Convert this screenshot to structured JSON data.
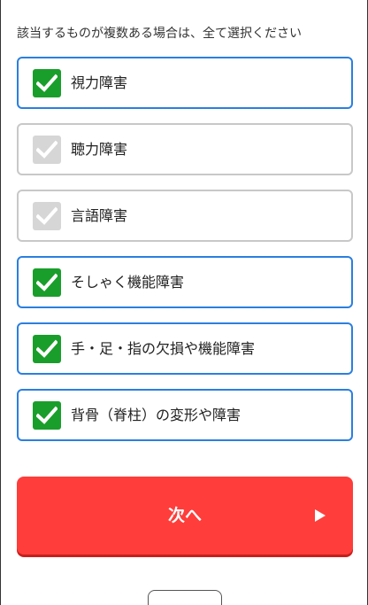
{
  "instruction": "該当するものが複数ある場合は、全て選択ください",
  "options": [
    {
      "label": "視力障害",
      "checked": true
    },
    {
      "label": "聴力障害",
      "checked": false
    },
    {
      "label": "言語障害",
      "checked": false
    },
    {
      "label": "そしゃく機能障害",
      "checked": true
    },
    {
      "label": "手・足・指の欠損や機能障害",
      "checked": true
    },
    {
      "label": "背骨（脊柱）の変形や障害",
      "checked": true
    }
  ],
  "next_button": {
    "label": "次へ",
    "icon": "play-arrow-icon"
  },
  "colors": {
    "checked_border": "#2b7fe0",
    "unchecked_border": "#c8c8c8",
    "checkbox_checked": "#1a9e2b",
    "checkbox_unchecked": "#d6d6d6",
    "next_button": "#ff3d3a"
  }
}
